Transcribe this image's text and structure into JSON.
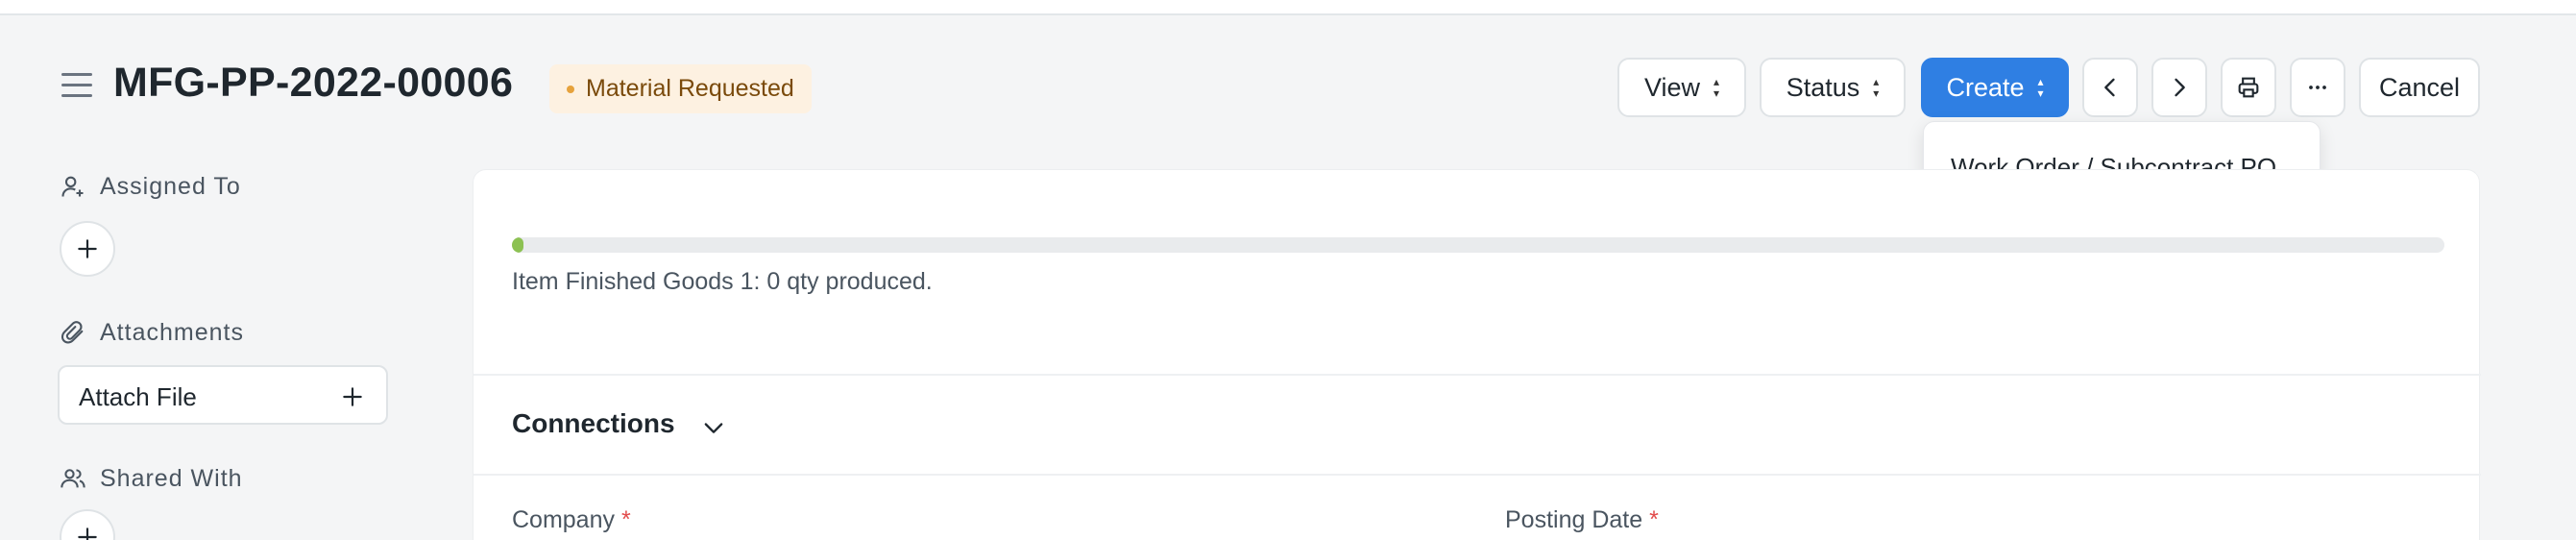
{
  "header": {
    "title": "MFG-PP-2022-00006",
    "status": "Material Requested"
  },
  "toolbar": {
    "view_label": "View",
    "status_label": "Status",
    "create_label": "Create",
    "cancel_label": "Cancel"
  },
  "create_menu": {
    "items": [
      "Work Order / Subcontract PO"
    ]
  },
  "sidebar": {
    "assigned_to": "Assigned To",
    "attachments": "Attachments",
    "attach_file": "Attach File",
    "shared_with": "Shared With"
  },
  "main": {
    "progress": {
      "value": 0.006,
      "text": "Item Finished Goods 1: 0 qty produced."
    },
    "connections_label": "Connections",
    "fields": [
      {
        "label": "Company",
        "required_mark": "*"
      },
      {
        "label": "Posting Date",
        "required_mark": "*"
      }
    ]
  },
  "colors": {
    "primary": "#2f7fe3",
    "status_bg": "#fdf1e1",
    "status_text": "#7a4a0b",
    "progress": "#8cc152",
    "required": "#e24c4c"
  }
}
